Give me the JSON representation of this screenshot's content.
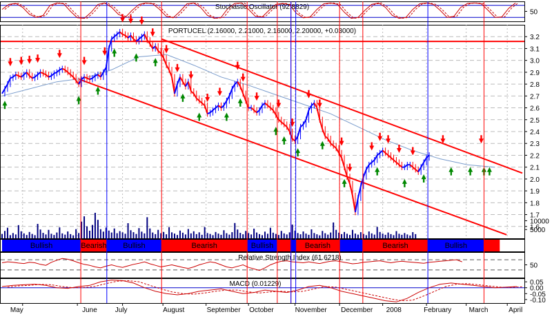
{
  "chart_data": {
    "type": "line",
    "instrument": "PORTUCEL",
    "colors": {
      "up": "#0000ff",
      "down": "#ff0000",
      "bullish_band": "#0000ff",
      "bearish_band": "#ff0000",
      "trendline": "#ff0000",
      "moving_average": "#7a9ccc",
      "indicator_line": "#cc0000",
      "signal_up": "#008800",
      "signal_down": "#ff0000",
      "grid": "#999999"
    },
    "price_panel": {
      "title": "PORTUCEL (2.16000, 2.21000, 2.16000, 2.20000, +0.03000)",
      "yticks": [
        "3.2",
        "3.1",
        "3.0",
        "2.9",
        "2.8",
        "2.7",
        "2.6",
        "2.5",
        "2.4",
        "2.3",
        "2.2",
        "2.1",
        "2.0",
        "1.9",
        "1.8",
        "1.7",
        "1.6"
      ],
      "ylim": [
        1.5,
        3.3
      ],
      "resistance_level": 3.16,
      "channel": {
        "upper": [
          {
            "day": 233,
            "value": 3.18
          },
          {
            "day": 760,
            "value": 2.05
          }
        ],
        "lower": [
          {
            "day": 113,
            "value": 2.84
          },
          {
            "day": 737,
            "value": 1.53
          }
        ]
      },
      "close_series": {
        "start_day": 0,
        "step_days": 4,
        "values": [
          2.72,
          2.76,
          2.8,
          2.85,
          2.86,
          2.88,
          2.87,
          2.86,
          2.88,
          2.9,
          2.87,
          2.85,
          2.86,
          2.88,
          2.9,
          2.89,
          2.88,
          2.86,
          2.87,
          2.89,
          2.9,
          2.92,
          2.93,
          2.92,
          2.9,
          2.88,
          2.86,
          2.83,
          2.8,
          2.84,
          2.86,
          2.85,
          2.84,
          2.85,
          2.87,
          2.88,
          2.86,
          2.9,
          2.94,
          3.1,
          3.18,
          3.2,
          3.22,
          3.24,
          3.22,
          3.21,
          3.19,
          3.21,
          3.18,
          3.16,
          3.18,
          3.2,
          3.22,
          3.17,
          3.14,
          3.1,
          3.12,
          3.08,
          3.06,
          3.02,
          2.96,
          2.92,
          2.86,
          2.72,
          2.8,
          2.86,
          2.82,
          2.78,
          2.82,
          2.74,
          2.72,
          2.68,
          2.66,
          2.64,
          2.62,
          2.55,
          2.56,
          2.58,
          2.6,
          2.62,
          2.6,
          2.62,
          2.66,
          2.7,
          2.76,
          2.8,
          2.82,
          2.78,
          2.72,
          2.66,
          2.6,
          2.6,
          2.58,
          2.56,
          2.58,
          2.62,
          2.64,
          2.62,
          2.6,
          2.58,
          2.54,
          2.5,
          2.48,
          2.46,
          2.44,
          2.4,
          2.34,
          2.32,
          2.36,
          2.44,
          2.46,
          2.5,
          2.58,
          2.62,
          2.64,
          2.6,
          2.5,
          2.42,
          2.36,
          2.34,
          2.3,
          2.28,
          2.26,
          2.22,
          2.18,
          2.1,
          2.02,
          1.96,
          1.86,
          1.72,
          1.84,
          1.94,
          2.02,
          2.08,
          2.12,
          2.14,
          2.16,
          2.2,
          2.22,
          2.24,
          2.22,
          2.2,
          2.18,
          2.16,
          2.14,
          2.12,
          2.1,
          2.1,
          2.12,
          2.12,
          2.1,
          2.08,
          2.06,
          2.1,
          2.14,
          2.18,
          2.2
        ]
      },
      "moving_average": {
        "start_day": 0,
        "step_days": 40,
        "values": [
          2.7,
          2.76,
          2.82,
          2.85,
          2.92,
          3.03,
          3.05,
          2.96,
          2.86,
          2.79,
          2.71,
          2.63,
          2.55,
          2.44,
          2.33,
          2.24,
          2.17,
          2.12,
          2.1
        ]
      },
      "signal_down_days": [
        12,
        28,
        40,
        52,
        84,
        120,
        150,
        176,
        188,
        204,
        220,
        240,
        256,
        276,
        300,
        318,
        344,
        352,
        372,
        404,
        424,
        448,
        464,
        496,
        508,
        540,
        552,
        564,
        580,
        600,
        644,
        700
      ],
      "signal_up_days": [
        4,
        112,
        140,
        164,
        196,
        224,
        264,
        288,
        328,
        348,
        400,
        412,
        432,
        468,
        500,
        548,
        588,
        616,
        656,
        684,
        704,
        712
      ]
    },
    "stochastic": {
      "title": "Stochastic Oscillator (92.8829)",
      "yticks": [
        "50"
      ],
      "ylim": [
        0,
        100
      ],
      "levels": [
        20,
        80
      ],
      "series": [
        {
          "start_day": 0,
          "step_days": 10,
          "values": [
            60,
            85,
            90,
            70,
            35,
            20,
            30,
            80,
            92,
            88,
            50,
            18,
            15,
            45,
            85,
            92,
            70,
            35,
            20,
            55,
            85,
            92,
            88,
            60,
            25,
            18,
            50,
            88,
            92,
            70,
            30,
            15,
            20,
            65,
            90,
            92,
            60,
            25,
            22,
            55,
            85,
            90,
            82,
            40,
            18,
            22,
            60,
            88,
            92,
            85,
            45,
            15,
            20,
            55,
            85,
            92,
            70,
            30,
            15,
            20,
            60,
            88,
            92,
            85,
            55,
            20,
            25,
            70,
            90,
            92,
            88,
            55,
            20,
            22,
            65,
            92
          ]
        }
      ]
    },
    "volume": {
      "yticks": [
        "10000",
        "5000"
      ],
      "ylim": [
        0,
        18000
      ],
      "series": [
        {
          "start_day": 0,
          "step_days": 4,
          "values": [
            2500,
            4200,
            6000,
            1800,
            3000,
            2200,
            7500,
            4000,
            2800,
            1900,
            3600,
            2500,
            1800,
            8200,
            5000,
            3100,
            2200,
            4800,
            2600,
            1900,
            3300,
            6200,
            2800,
            2100,
            3900,
            2400,
            1700,
            5200,
            3000,
            9500,
            12500,
            6800,
            4300,
            7600,
            14500,
            10500,
            5200,
            3800,
            6100,
            4400,
            3300,
            5600,
            2900,
            4100,
            3400,
            2600,
            8600,
            4600,
            3500,
            2500,
            5800,
            3800,
            2800,
            12000,
            5600,
            3300,
            2400,
            4800,
            2900,
            3600,
            2300,
            6300,
            3400,
            2700,
            1900,
            4400,
            3200,
            2200,
            5300,
            2800,
            4000,
            2400,
            3400,
            2000,
            6400,
            3000,
            2500,
            1800,
            3600,
            2700,
            2000,
            4600,
            2900,
            2100,
            3500,
            8700,
            5000,
            3100,
            2300,
            4200,
            3000,
            2200,
            5500,
            3300,
            2400,
            1800,
            3800,
            2600,
            6000,
            3200,
            2500,
            1900,
            4200,
            2800,
            2200,
            3400,
            7800,
            4400,
            3000,
            2300,
            3900,
            2700,
            2000,
            5100,
            3000,
            2300,
            1700,
            4200,
            2900,
            2100,
            3300,
            9000,
            4800,
            3200,
            2400,
            3600,
            2600,
            1900,
            4800,
            2700,
            2100,
            3500,
            2500,
            1800,
            3900,
            2800,
            2100,
            6500,
            3600,
            2700,
            2000,
            3300,
            2400,
            1800,
            4100,
            2600,
            2000,
            3000,
            2200,
            1600,
            3500,
            2400
          ]
        }
      ]
    },
    "trend_bands": [
      {
        "label": "Bullish",
        "start_day": 0,
        "end_day": 115,
        "state": "bull"
      },
      {
        "label": "Bearish",
        "start_day": 115,
        "end_day": 153,
        "state": "bear"
      },
      {
        "label": "Bullish",
        "start_day": 153,
        "end_day": 233,
        "state": "bull"
      },
      {
        "label": "Bearish",
        "start_day": 233,
        "end_day": 358,
        "state": "bear"
      },
      {
        "label": "Bullish",
        "start_day": 358,
        "end_day": 402,
        "state": "bull"
      },
      {
        "label": "",
        "start_day": 402,
        "end_day": 422,
        "state": "bear"
      },
      {
        "label": "",
        "start_day": 422,
        "end_day": 429,
        "state": "bull"
      },
      {
        "label": "Bearish",
        "start_day": 429,
        "end_day": 493,
        "state": "bear"
      },
      {
        "label": "",
        "start_day": 493,
        "end_day": 527,
        "state": "bull"
      },
      {
        "label": "Bearish",
        "start_day": 527,
        "end_day": 622,
        "state": "bear"
      },
      {
        "label": "Bullish",
        "start_day": 622,
        "end_day": 704,
        "state": "bull"
      },
      {
        "label": "",
        "start_day": 704,
        "end_day": 727,
        "state": "bear"
      }
    ],
    "rsi": {
      "title": "Relative Strength Index (61.6218)",
      "yticks": [
        "50"
      ],
      "ylim": [
        0,
        100
      ],
      "levels": [
        30,
        70
      ],
      "series": [
        {
          "start_day": 0,
          "step_days": 8,
          "values": [
            58,
            62,
            60,
            57,
            55,
            60,
            58,
            52,
            48,
            60,
            68,
            75,
            72,
            66,
            58,
            52,
            48,
            42,
            38,
            45,
            50,
            44,
            40,
            46,
            52,
            56,
            62,
            54,
            48,
            42,
            46,
            50,
            45,
            40,
            36,
            42,
            50,
            56,
            62,
            58,
            50,
            42,
            38,
            44,
            50,
            40,
            34,
            28,
            38,
            50,
            58,
            64,
            66,
            62,
            60,
            58,
            62,
            58,
            55,
            60,
            64,
            66,
            62,
            58,
            54,
            56,
            60,
            62,
            64,
            66,
            62,
            58,
            62,
            64,
            62,
            60,
            58,
            56,
            60,
            62,
            64,
            66,
            68,
            70,
            62
          ]
        }
      ]
    },
    "macd": {
      "title": "MACD (0.01229)",
      "yticks": [
        "0.05",
        "0.00",
        "-0.05",
        "-0.10"
      ],
      "ylim": [
        -0.13,
        0.08
      ],
      "levels": [
        0
      ],
      "series": [
        {
          "start_day": 0,
          "step_days": 16,
          "values": [
            0.01,
            0.02,
            0.025,
            0.03,
            0.02,
            0.0,
            -0.005,
            0.01,
            0.02,
            0.05,
            0.065,
            0.06,
            0.04,
            0.0,
            -0.03,
            -0.05,
            -0.06,
            -0.05,
            -0.03,
            -0.02,
            -0.01,
            -0.03,
            -0.05,
            -0.04,
            -0.02,
            -0.03,
            -0.04,
            -0.02,
            0.01,
            0.02,
            0.0,
            -0.03,
            -0.05,
            -0.07,
            -0.09,
            -0.11,
            -0.12,
            -0.09,
            -0.04,
            0.0,
            0.03,
            0.04,
            0.03,
            0.02,
            0.01,
            0.0,
            0.005,
            0.01,
            0.012
          ]
        },
        {
          "start_day": 8,
          "step_days": 16,
          "values": [
            0.005,
            0.015,
            0.02,
            0.028,
            0.025,
            0.01,
            0.0,
            0.002,
            0.012,
            0.035,
            0.055,
            0.06,
            0.05,
            0.02,
            -0.01,
            -0.035,
            -0.05,
            -0.055,
            -0.045,
            -0.03,
            -0.02,
            -0.02,
            -0.035,
            -0.045,
            -0.035,
            -0.03,
            -0.035,
            -0.03,
            -0.01,
            0.01,
            0.005,
            -0.015,
            -0.035,
            -0.055,
            -0.075,
            -0.095,
            -0.11,
            -0.105,
            -0.07,
            -0.03,
            0.01,
            0.03,
            0.035,
            0.025,
            0.015,
            0.005,
            0.003,
            0.008
          ]
        }
      ]
    },
    "vertical_markers": {
      "red_days": [
        115,
        233,
        358,
        402,
        422,
        493,
        527,
        704
      ],
      "blue_days": [
        153,
        422,
        429,
        622
      ]
    },
    "x_axis": {
      "labels": [
        {
          "label": "May",
          "day": 10
        },
        {
          "label": "June",
          "day": 115
        },
        {
          "label": "July",
          "day": 163
        },
        {
          "label": "August",
          "day": 233
        },
        {
          "label": "September",
          "day": 297
        },
        {
          "label": "October",
          "day": 359
        },
        {
          "label": "November",
          "day": 426
        },
        {
          "label": "December",
          "day": 493
        },
        {
          "label": "2008",
          "day": 559
        },
        {
          "label": "February",
          "day": 614
        },
        {
          "label": "March",
          "day": 680
        },
        {
          "label": "April",
          "day": 738
        }
      ],
      "gridline_days": [
        30,
        110,
        176,
        235,
        298,
        360,
        428,
        493,
        556,
        620,
        678,
        738
      ]
    }
  }
}
